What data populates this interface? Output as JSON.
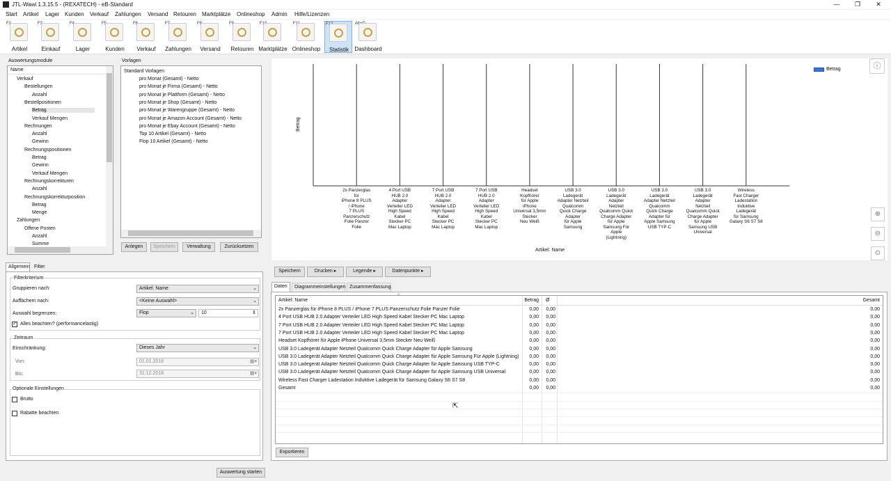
{
  "window": {
    "title": "JTL-Wawi 1.3.15.5 - (REXATECH) - eB-Standard",
    "min": "—",
    "restore": "❐",
    "close": "✕"
  },
  "menu": [
    "Start",
    "Artikel",
    "Lager",
    "Kunden",
    "Versand",
    "Zahlungen",
    "Versand",
    "Retouren",
    "Marktplätze",
    "Onlineshop",
    "Admin",
    "Hilfe/Lizenzen"
  ],
  "menu_fixed": [
    "Start",
    "Artikel",
    "Lager",
    "Kunden",
    "Verkauf",
    "Zahlungen",
    "Versand",
    "Retouren",
    "Marktplätze",
    "Onlineshop",
    "Admin",
    "Hilfe/Lizenzen"
  ],
  "toolbar": [
    {
      "key": "F2",
      "label": "Artikel",
      "icon": "article-icon"
    },
    {
      "key": "F3",
      "label": "Einkauf",
      "icon": "purchase-icon"
    },
    {
      "key": "F4",
      "label": "Lager",
      "icon": "warehouse-icon"
    },
    {
      "key": "F5",
      "label": "Kunden",
      "icon": "customers-icon"
    },
    {
      "key": "F6",
      "label": "Verkauf",
      "icon": "sales-icon"
    },
    {
      "key": "F7",
      "label": "Zahlungen",
      "icon": "payments-icon"
    },
    {
      "key": "F8",
      "label": "Versand",
      "icon": "shipping-icon"
    },
    {
      "key": "F9",
      "label": "Retouren",
      "icon": "returns-icon"
    },
    {
      "key": "F10",
      "label": "Marktplätze",
      "icon": "marketplaces-icon"
    },
    {
      "key": "F11",
      "label": "Onlineshop",
      "icon": "onlineshop-icon"
    },
    {
      "key": "F12",
      "label": "Statistik",
      "icon": "statistics-icon"
    },
    {
      "key": "Alt+D",
      "label": "Dashboard",
      "icon": "dashboard-icon"
    }
  ],
  "modules": {
    "title": "Auswertungsmodule",
    "header": "Name",
    "items": [
      "Verkauf",
      "Bestellungen",
      "Anzahl",
      "Bestellpositionen",
      "Betrag",
      "Verkauf Mengen",
      "Rechnungen",
      "Anzahl",
      "Gewinn",
      "Rechnungspositionen",
      "Betrag",
      "Gewinn",
      "Verkauf Mengen",
      "Rechnungskorrekturen",
      "Anzahl",
      "Rechnungskorrekturposition",
      "Betrag",
      "Menge",
      "Zahlungen",
      "Offene Posten",
      "Anzahl",
      "Summe"
    ]
  },
  "templates": {
    "title": "Vorlagen",
    "root": "Standard Vorlagen",
    "items": [
      "pro Monat (Gesamt) - Netto",
      "pro Monat je Firma (Gesamt) - Netto",
      "pro Monat je Plattform (Gesamt) - Netto",
      "pro Monat je Shop (Gesamt) - Netto",
      "pro Monat je Warengruppe (Gesamt) - Netto",
      "pro Monat je Amazon Account (Gesamt) - Netto",
      "pro Monat je Ebay Account (Gesamt) - Netto",
      "Top 10 Artikel (Gesamt) - Netto",
      "Flop 10 Artikel (Gesamt) - Netto"
    ],
    "buttons": {
      "add": "Anlegen",
      "save": "Speichern",
      "manage": "Verwaltung",
      "reset": "Zurücksetzen"
    }
  },
  "filter": {
    "tab_general": "Allgemein",
    "tab_filter": "Filter",
    "group_criteria": "Filterkriterium",
    "group_by_label": "Gruppieren nach:",
    "group_by": "Artikel: Name",
    "split_label": "Auffächern nach:",
    "split": "<Keine Auswahl>",
    "limit_label": "Auswahl begrenzen:",
    "limit": "Flop",
    "limit_count": "10",
    "all_label": "Alles beachten? (performancelastig)",
    "group_period": "Zeitraum",
    "restrict_label": "Einschränkung:",
    "restrict": "Dieses Jahr",
    "from_label": "Von:",
    "from": "01.01.2018",
    "to_label": "Bis:",
    "to": "31.12.2018",
    "group_optional": "Optionale Einstellungen",
    "gross_label": "Brutto",
    "discount_label": "Rabatte beachten",
    "start_button": "Auswertung starten"
  },
  "chart_data": {
    "type": "bar",
    "xlabel": "Artikel: Name",
    "ylabel": "Betrag",
    "legend": "top-right",
    "series": [
      {
        "name": "Betrag",
        "values": [
          0,
          0,
          0,
          0,
          0,
          0,
          0,
          0,
          0,
          0
        ]
      }
    ],
    "categories": [
      "2x Panzerglas\nfür\niPhone 8 PLUS\n/ iPhone\n7 PLUS\nPanzerschutz\nFolie Panzer\nFolie",
      "4 Port USB\nHUB 2.0\nAdapter\nVerteiler LED\nHigh Speed\nKabel\nStecker PC\nMac Laptop",
      "7 Port USB\nHUB 2.0\nAdapter\nVerteiler LED\nHigh Speed\nKabel\nStecker PC\nMac Laptop",
      "7 Port USB\nHUB 2.0\nAdapter\nVerteiler LED\nHigh Speed\nKabel\nStecker PC\nMac Laptop",
      "Headset\nKopfhörer\nfür Apple\niPhone\nUniversal 3,5mm\nStecker\nNeu Weiß",
      "USB 3.0\nLadegerät\nAdapter Netzteil\nQualcomm\nQuick Charge\nAdapter\nfür Apple\nSamsung",
      "USB 3.0\nLadegerät\nAdapter\nNetzteil\nQualcomm Quick\nCharge Adapter\nfür Apple\nSamsung Für\nApple\n(Lightning)",
      "USB 3.0\nLadegerät\nAdapter Netzteil\nQualcomm\nQuick Charge\nAdapter für\nApple Samsung\nUSB TYP-C",
      "USB 3.0\nLadegerät\nAdapter\nNetzteil\nQualcomm Quick\nCharge Adapter\nfür Apple\nSamsung USB\nUniversal",
      "Wireless\nFast Charger\nLadestation\nInduktive\nLadegerät\nfür Samsung\nGalaxy S6 S7 S8"
    ]
  },
  "chart_toolbar": {
    "save": "Speichern",
    "print": "Drucken",
    "legend": "Legende",
    "points": "Datenpunkte"
  },
  "tabs": {
    "data": "Daten",
    "settings": "Diagrammeinstellungen",
    "summary": "Zusammenfassung"
  },
  "table": {
    "headers": [
      "Artikel: Name",
      "Betrag",
      "Ø",
      "Gesamt"
    ],
    "rows": [
      [
        "2x Panzerglas für iPhone 8 PLUS / iPhone 7 PLUS Panzerschutz Folie Panzer Folie",
        "0,00",
        "0,00",
        "0,00"
      ],
      [
        "4 Port USB HUB 2.0 Adapter Verteiler LED High Speed Kabel Stecker PC Mac Laptop",
        "0,00",
        "0,00",
        "0,00"
      ],
      [
        "7 Port USB HUB 2.0 Adapter Verteiler LED High Speed Kabel Stecker PC Mac Laptop",
        "0,00",
        "0,00",
        "0,00"
      ],
      [
        "7 Port USB HUB 2.0 Adapter Verteiler LED High Speed Kabel Stecker PC Mac Laptop",
        "0,00",
        "0,00",
        "0,00"
      ],
      [
        "Headset Kopfhörer für Apple iPhone Universal 3,5mm Stecker Neu Weiß",
        "0,00",
        "0,00",
        "0,00"
      ],
      [
        "USB 3.0 Ladegerät Adapter Netzteil Qualcomm Quick Charge Adapter für Apple Samsung",
        "0,00",
        "0,00",
        "0,00"
      ],
      [
        "USB 3.0 Ladegerät Adapter Netzteil Qualcomm Quick Charge Adapter für Apple Samsung Für Apple (Lightning)",
        "0,00",
        "0,00",
        "0,00"
      ],
      [
        "USB 3.0 Ladegerät Adapter Netzteil Qualcomm Quick Charge Adapter für Apple Samsung USB TYP-C",
        "0,00",
        "0,00",
        "0,00"
      ],
      [
        "USB 3.0 Ladegerät Adapter Netzteil Qualcomm Quick Charge Adapter für Apple Samsung USB Universal",
        "0,00",
        "0,00",
        "0,00"
      ],
      [
        "Wireless Fast Charger Ladestation Induktive Ladegerät für Samsung Galaxy S6 S7 S8",
        "0,00",
        "0,00",
        "0,00"
      ],
      [
        "Gesamt",
        "0,00",
        "0,00",
        "0,00"
      ]
    ]
  },
  "export_button": "Exportieren",
  "colors": {
    "accent": "#3c78d8",
    "selected": "#cfe3f6"
  }
}
